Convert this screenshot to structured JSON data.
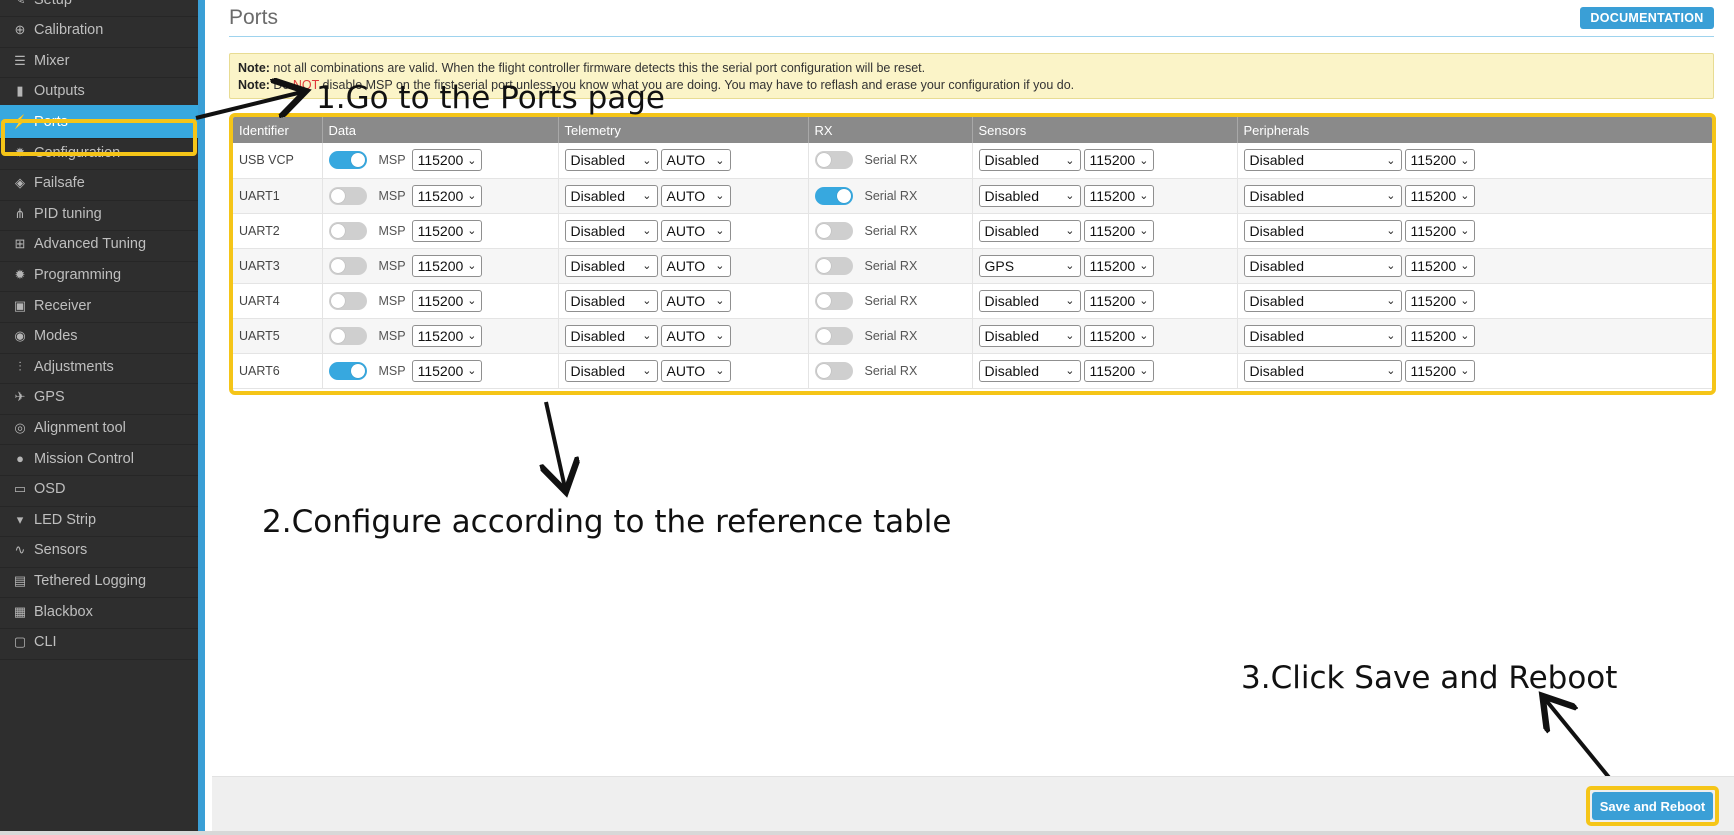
{
  "sidebar": {
    "items": [
      {
        "label": "Setup",
        "icon": "wrench-icon"
      },
      {
        "label": "Calibration",
        "icon": "crosshair-icon"
      },
      {
        "label": "Mixer",
        "icon": "mixer-icon"
      },
      {
        "label": "Outputs",
        "icon": "outputs-icon"
      },
      {
        "label": "Ports",
        "icon": "plug-icon"
      },
      {
        "label": "Configuration",
        "icon": "gear-icon"
      },
      {
        "label": "Failsafe",
        "icon": "failsafe-icon"
      },
      {
        "label": "PID tuning",
        "icon": "pid-icon"
      },
      {
        "label": "Advanced Tuning",
        "icon": "advanced-tuning-icon"
      },
      {
        "label": "Programming",
        "icon": "gear-icon"
      },
      {
        "label": "Receiver",
        "icon": "receiver-icon"
      },
      {
        "label": "Modes",
        "icon": "modes-icon"
      },
      {
        "label": "Adjustments",
        "icon": "sliders-icon"
      },
      {
        "label": "GPS",
        "icon": "satellite-icon"
      },
      {
        "label": "Alignment tool",
        "icon": "compass-icon"
      },
      {
        "label": "Mission Control",
        "icon": "map-pin-icon"
      },
      {
        "label": "OSD",
        "icon": "osd-icon"
      },
      {
        "label": "LED Strip",
        "icon": "led-icon"
      },
      {
        "label": "Sensors",
        "icon": "pulse-icon"
      },
      {
        "label": "Tethered Logging",
        "icon": "logging-icon"
      },
      {
        "label": "Blackbox",
        "icon": "blackbox-icon"
      },
      {
        "label": "CLI",
        "icon": "terminal-icon"
      }
    ],
    "active": "Ports",
    "accent_color": "#37a8df"
  },
  "header": {
    "title": "Ports",
    "documentation_label": "DOCUMENTATION"
  },
  "notes": {
    "note1_label": "Note:",
    "note1_text": " not all combinations are valid. When the flight controller firmware detects this the serial port configuration will be reset.",
    "note2_label": "Note:",
    "note2_pre": " Do ",
    "note2_emph": "NOT",
    "note2_post": " disable MSP on the first serial port unless you know what you are doing. You may have to reflash and erase your configuration if you do."
  },
  "table": {
    "columns": [
      "Identifier",
      "Data",
      "Telemetry",
      "RX",
      "Sensors",
      "Peripherals"
    ],
    "msp_label": "MSP",
    "serial_rx_label": "Serial RX",
    "rows": [
      {
        "id": "USB VCP",
        "msp_on": true,
        "msp_baud": "115200",
        "telemetry": "Disabled",
        "telemetry_baud": "AUTO",
        "serial_rx_on": false,
        "sensor": "Disabled",
        "sensor_baud": "115200",
        "peripheral": "Disabled",
        "peripheral_baud": "115200"
      },
      {
        "id": "UART1",
        "msp_on": false,
        "msp_baud": "115200",
        "telemetry": "Disabled",
        "telemetry_baud": "AUTO",
        "serial_rx_on": true,
        "sensor": "Disabled",
        "sensor_baud": "115200",
        "peripheral": "Disabled",
        "peripheral_baud": "115200"
      },
      {
        "id": "UART2",
        "msp_on": false,
        "msp_baud": "115200",
        "telemetry": "Disabled",
        "telemetry_baud": "AUTO",
        "serial_rx_on": false,
        "sensor": "Disabled",
        "sensor_baud": "115200",
        "peripheral": "Disabled",
        "peripheral_baud": "115200"
      },
      {
        "id": "UART3",
        "msp_on": false,
        "msp_baud": "115200",
        "telemetry": "Disabled",
        "telemetry_baud": "AUTO",
        "serial_rx_on": false,
        "sensor": "GPS",
        "sensor_baud": "115200",
        "peripheral": "Disabled",
        "peripheral_baud": "115200"
      },
      {
        "id": "UART4",
        "msp_on": false,
        "msp_baud": "115200",
        "telemetry": "Disabled",
        "telemetry_baud": "AUTO",
        "serial_rx_on": false,
        "sensor": "Disabled",
        "sensor_baud": "115200",
        "peripheral": "Disabled",
        "peripheral_baud": "115200"
      },
      {
        "id": "UART5",
        "msp_on": false,
        "msp_baud": "115200",
        "telemetry": "Disabled",
        "telemetry_baud": "AUTO",
        "serial_rx_on": false,
        "sensor": "Disabled",
        "sensor_baud": "115200",
        "peripheral": "Disabled",
        "peripheral_baud": "115200"
      },
      {
        "id": "UART6",
        "msp_on": true,
        "msp_baud": "115200",
        "telemetry": "Disabled",
        "telemetry_baud": "AUTO",
        "serial_rx_on": false,
        "sensor": "Disabled",
        "sensor_baud": "115200",
        "peripheral": "Disabled",
        "peripheral_baud": "115200"
      }
    ]
  },
  "annotations": {
    "step1": "1.Go to the Ports page",
    "step2": "2.Configure according to the reference table",
    "step3": "3.Click Save and Reboot",
    "highlight_color": "#f5c518"
  },
  "footer": {
    "save_label": "Save and Reboot"
  }
}
